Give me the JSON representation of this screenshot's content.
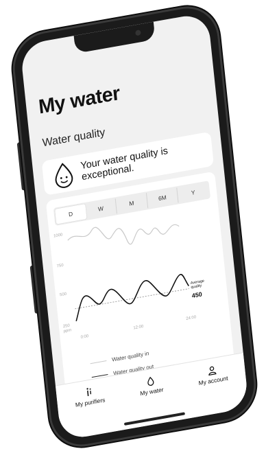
{
  "page": {
    "title": "My water"
  },
  "section": {
    "title": "Water quality"
  },
  "status": {
    "message_line1": "Your water quality is",
    "message_line2": "exceptional.",
    "icon": "happy-water-drop-icon"
  },
  "range_tabs": [
    "D",
    "W",
    "M",
    "6M",
    "Y"
  ],
  "range_tab_selected": "D",
  "chart": {
    "top_y_ticks": [
      "1000",
      "750"
    ],
    "bottom_y_ticks": [
      "500",
      "250",
      "ppm"
    ],
    "x_ticks": [
      "0:00",
      "12:00",
      "24:00"
    ],
    "average_label_line1": "Average",
    "average_label_line2": "quality",
    "average_value": "450"
  },
  "chart_data": {
    "type": "line",
    "x": [
      "0:00",
      "12:00",
      "24:00"
    ],
    "series": [
      {
        "name": "Water quality in",
        "values_top_panel": [
          900,
          960,
          880,
          780,
          900,
          850,
          870,
          830,
          860
        ]
      },
      {
        "name": "Water quality out",
        "values_bottom_panel": [
          250,
          450,
          320,
          480,
          330,
          470,
          340,
          480,
          400
        ]
      }
    ],
    "annotations": [
      {
        "label": "Average quality",
        "value": 450
      }
    ]
  },
  "legend": [
    {
      "label": "Water quality in",
      "color": "#c9c9c9"
    },
    {
      "label": "Water quality out",
      "color": "#222222"
    }
  ],
  "pager": {
    "count": 3,
    "active_index": 2
  },
  "nav": [
    {
      "label": "My purifiers",
      "icon": "purifier-icon"
    },
    {
      "label": "My water",
      "icon": "water-drop-icon"
    },
    {
      "label": "My account",
      "icon": "person-icon"
    }
  ]
}
